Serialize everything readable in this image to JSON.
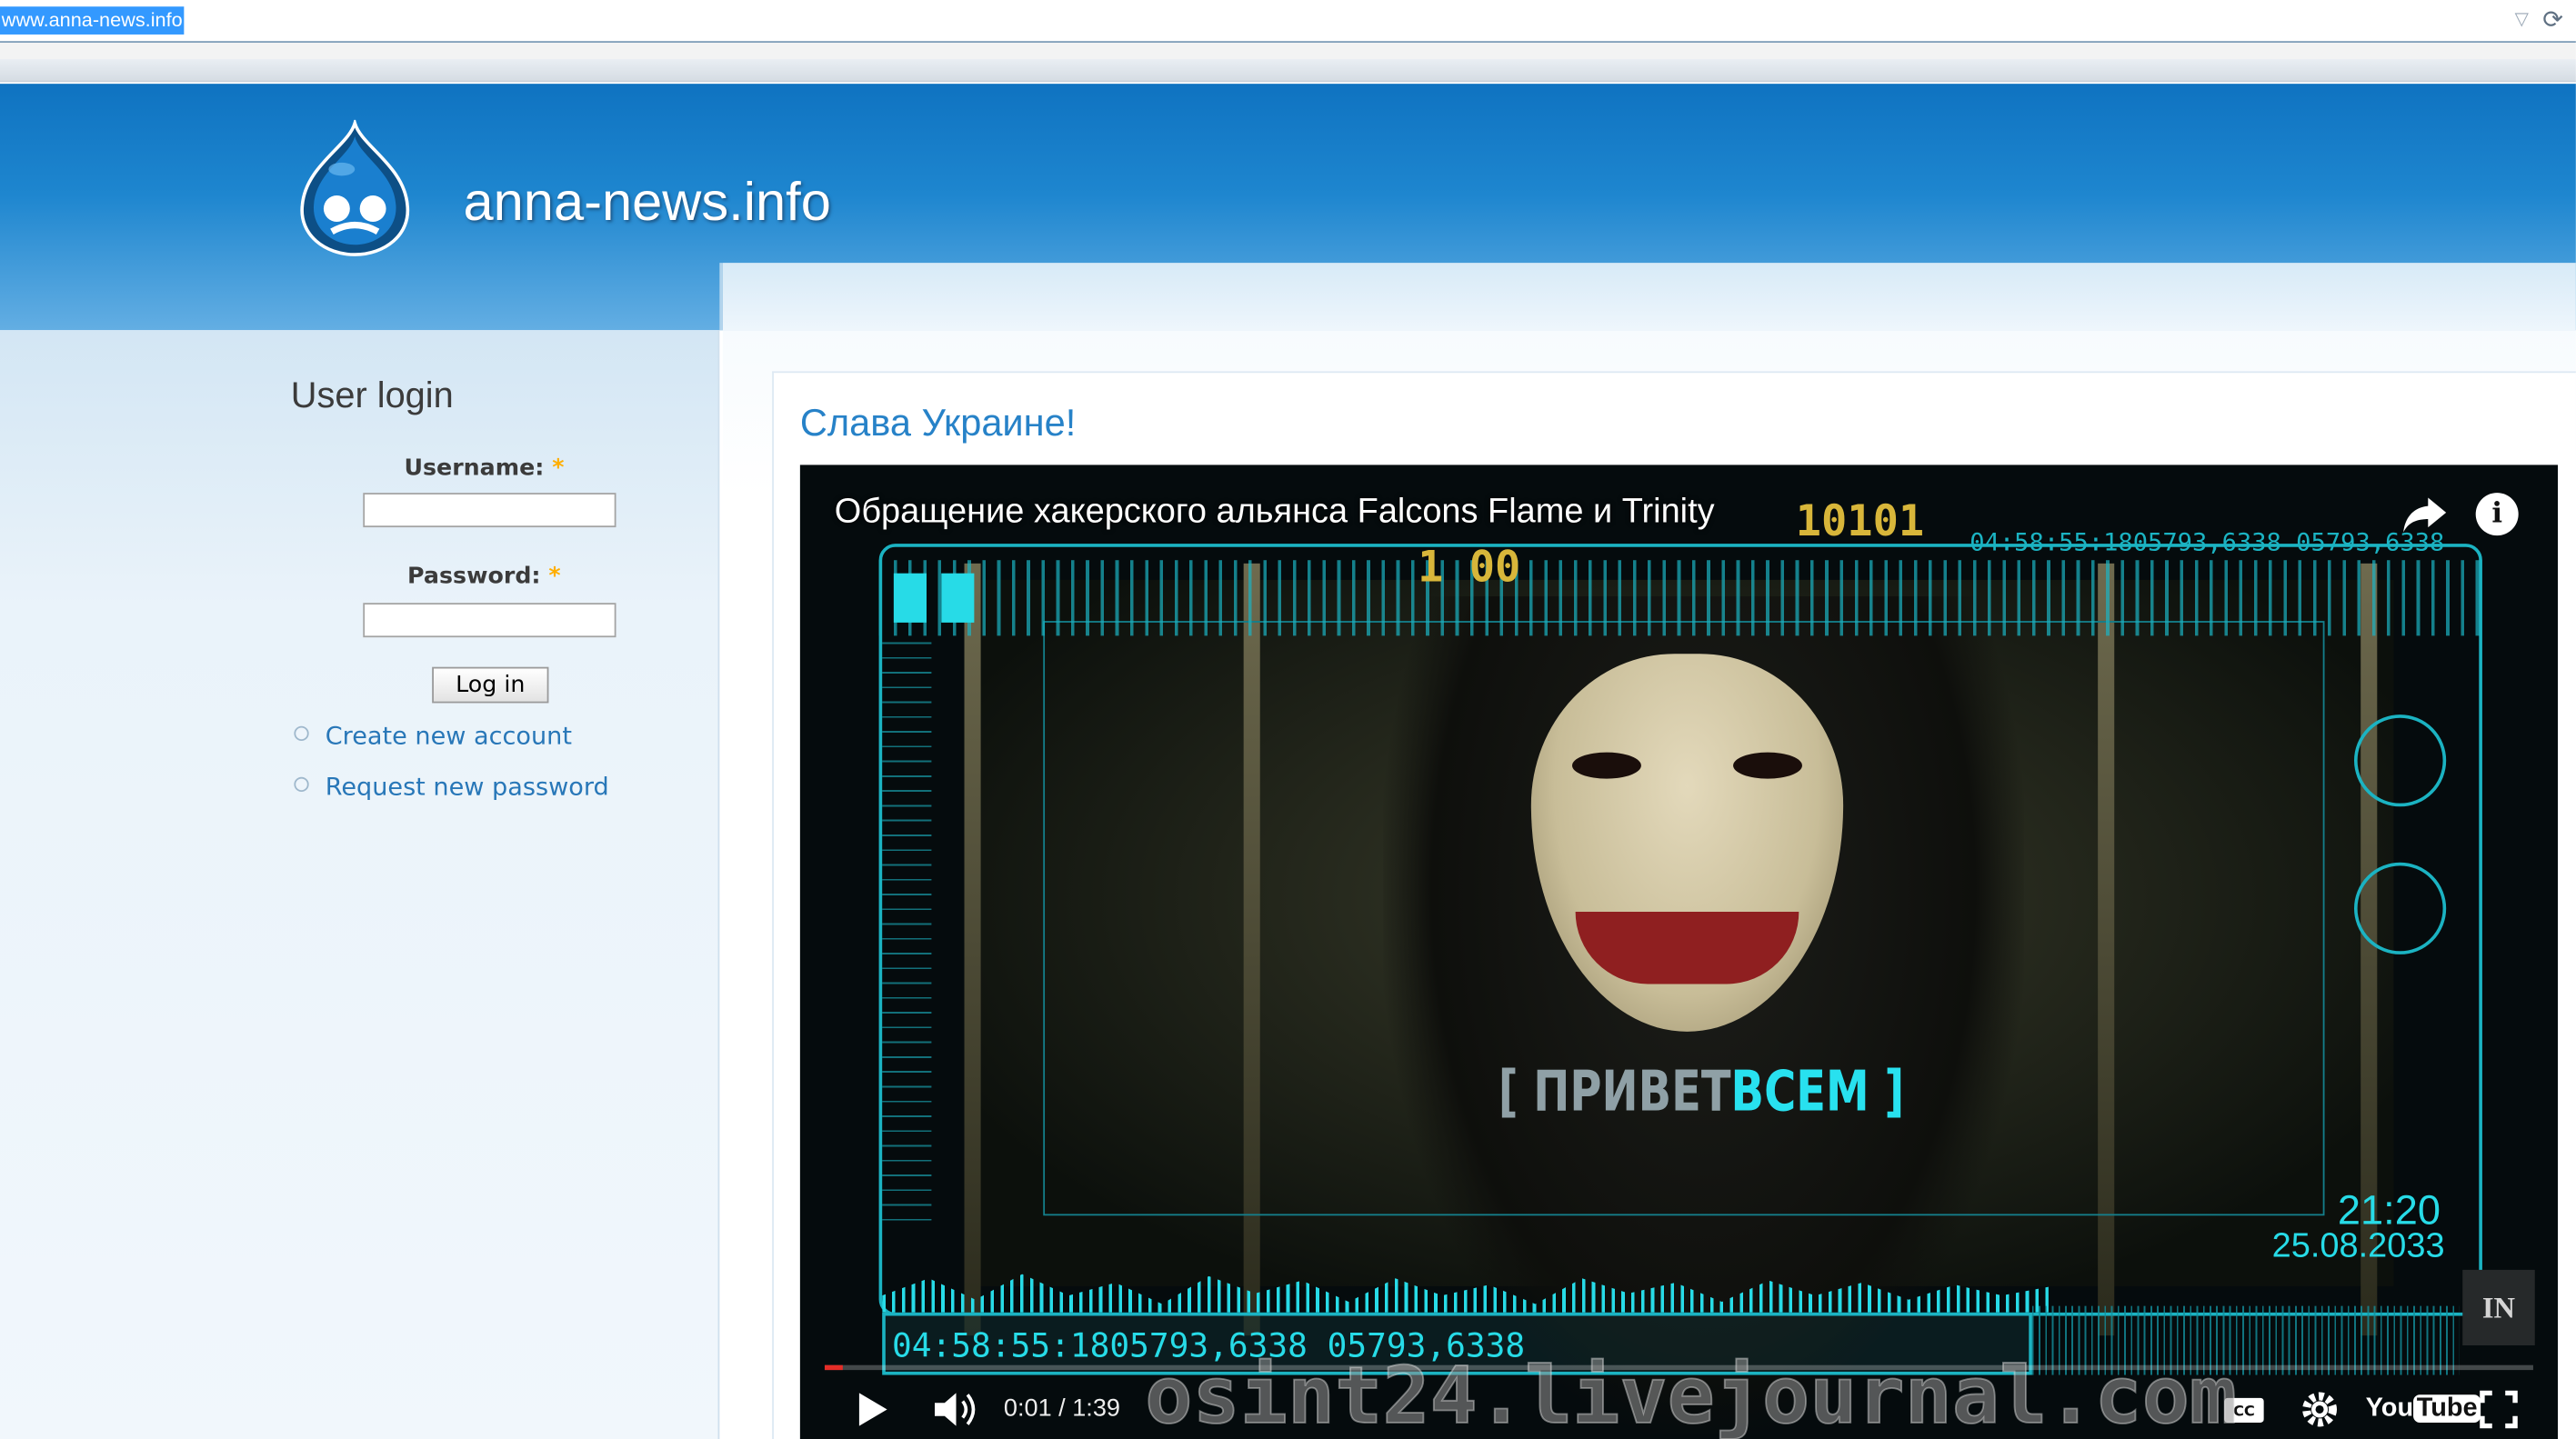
{
  "browser": {
    "url": "www.anna-news.info"
  },
  "site": {
    "name": "anna-news.info"
  },
  "login": {
    "title": "User login",
    "username_label": "Username:",
    "password_label": "Password:",
    "required_mark": "*",
    "login_button": "Log in",
    "links": [
      "Create new account",
      "Request new password"
    ]
  },
  "article": {
    "title": "Слава Украине!"
  },
  "video": {
    "title": "Обращение хакерского альянса Falcons Flame и Trinity",
    "greeting_part1": "[ ПРИВЕТ",
    "greeting_part2": "ВСЕМ ]",
    "code_top": "04:58:55:1805793,6338 05793,6338",
    "code_bottom": "04:58:55:1805793,6338 05793,6338",
    "digits_1": "10101",
    "digits_2": "1 00",
    "clock": "21:20",
    "date": "25.08.2033",
    "logo_text": "IN",
    "time_display": "0:01 / 1:39",
    "youtube_label": "You",
    "youtube_tube": "Tube",
    "progress_fraction": 0.0101
  },
  "watermark": {
    "text": "osint24.livejournal.com"
  },
  "colors": {
    "header_blue": "#1e86cf",
    "link_blue": "#2877b8",
    "title_blue": "#2782c8",
    "required_orange": "#ffae00",
    "video_cyan": "#27dbe7",
    "progress_red": "#e52d27"
  }
}
